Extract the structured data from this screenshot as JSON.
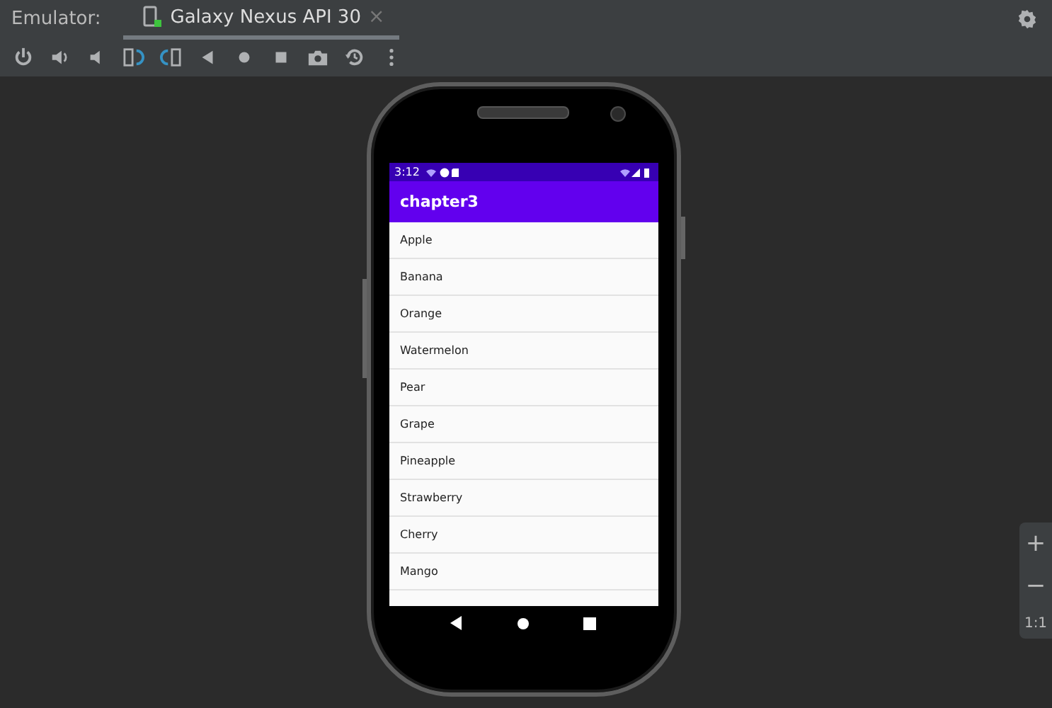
{
  "header": {
    "label": "Emulator:",
    "tab": {
      "title": "Galaxy Nexus API 30",
      "selected": true,
      "close": "×"
    }
  },
  "toolbar": {
    "buttons": [
      {
        "kind": "power"
      },
      {
        "kind": "volume-up"
      },
      {
        "kind": "volume-down"
      },
      {
        "kind": "rotate-left"
      },
      {
        "kind": "rotate-right"
      },
      {
        "kind": "back"
      },
      {
        "kind": "home"
      },
      {
        "kind": "overview"
      },
      {
        "kind": "camera"
      },
      {
        "kind": "snapshot"
      },
      {
        "kind": "more"
      }
    ]
  },
  "device": {
    "status_bar": {
      "time": "3:12"
    },
    "app_bar": {
      "title": "chapter3"
    },
    "items": [
      "Apple",
      "Banana",
      "Orange",
      "Watermelon",
      "Pear",
      "Grape",
      "Pineapple",
      "Strawberry",
      "Cherry",
      "Mango"
    ]
  },
  "zoom_panel": {
    "zoom_in": "+",
    "zoom_out": "−",
    "actual_size": "1:1"
  }
}
